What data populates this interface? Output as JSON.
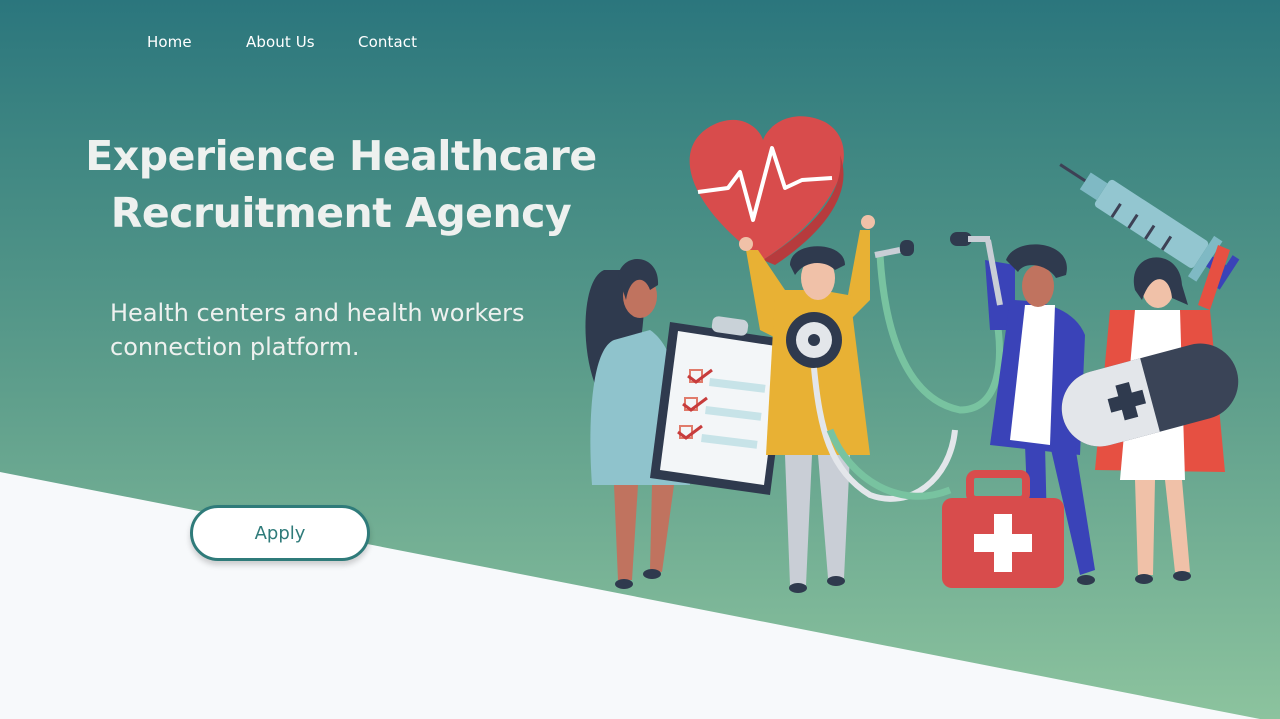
{
  "nav": {
    "items": [
      "Home",
      "About Us",
      "Contact"
    ]
  },
  "hero": {
    "headline_line1": "Experience Healthcare",
    "headline_line2": "Recruitment Agency",
    "subtitle_line1": "Health centers and health workers",
    "subtitle_line2": "connection platform.",
    "cta_label": "Apply"
  },
  "colors": {
    "gradient_top": "#2b767d",
    "gradient_bottom": "#8cc39e",
    "accent": "#2f7b7a",
    "heart": "#d84c4c"
  },
  "illustration": {
    "icons": [
      "heart-icon",
      "syringe-icon",
      "stethoscope-icon",
      "clipboard-icon",
      "pill-icon",
      "first-aid-kit-icon"
    ]
  }
}
